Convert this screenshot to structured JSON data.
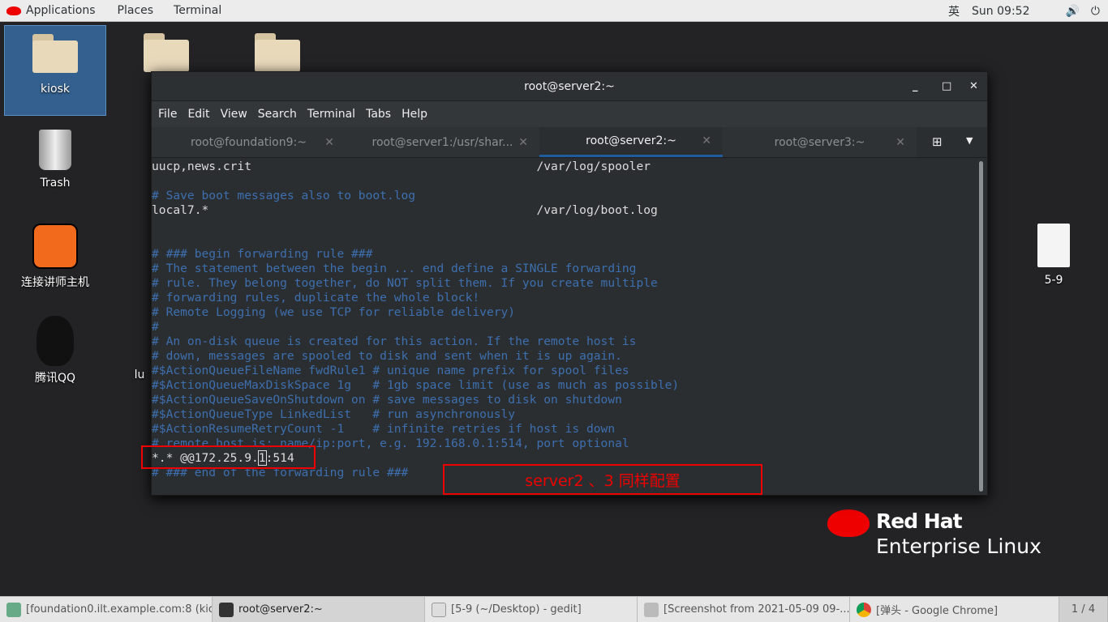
{
  "topbar": {
    "menus": [
      "Applications",
      "Places",
      "Terminal"
    ],
    "ime": "英",
    "clock": "Sun 09:52"
  },
  "desktop": {
    "icons": [
      "kiosk",
      "Trash",
      "连接讲师主机",
      "腾讯QQ",
      "lu",
      "5-9"
    ],
    "brand_line1": "Red Hat",
    "brand_line2": "Enterprise Linux"
  },
  "window": {
    "title": "root@server2:~",
    "menu": [
      "File",
      "Edit",
      "View",
      "Search",
      "Terminal",
      "Tabs",
      "Help"
    ],
    "tabs": [
      {
        "label": "root@foundation9:~"
      },
      {
        "label": "root@server1:/usr/shar..."
      },
      {
        "label": "root@server2:~",
        "active": true
      },
      {
        "label": "root@server3:~"
      }
    ]
  },
  "terminal": {
    "lines": [
      {
        "t": "uucp,news.crit                                        /var/log/spooler",
        "c": false
      },
      {
        "t": "",
        "c": false
      },
      {
        "t": "# Save boot messages also to boot.log",
        "c": true
      },
      {
        "t": "local7.*                                              /var/log/boot.log",
        "c": false
      },
      {
        "t": "",
        "c": false
      },
      {
        "t": "",
        "c": false
      },
      {
        "t": "# ### begin forwarding rule ###",
        "c": true
      },
      {
        "t": "# The statement between the begin ... end define a SINGLE forwarding",
        "c": true
      },
      {
        "t": "# rule. They belong together, do NOT split them. If you create multiple",
        "c": true
      },
      {
        "t": "# forwarding rules, duplicate the whole block!",
        "c": true
      },
      {
        "t": "# Remote Logging (we use TCP for reliable delivery)",
        "c": true
      },
      {
        "t": "#",
        "c": true
      },
      {
        "t": "# An on-disk queue is created for this action. If the remote host is",
        "c": true
      },
      {
        "t": "# down, messages are spooled to disk and sent when it is up again.",
        "c": true
      },
      {
        "t": "#$ActionQueueFileName fwdRule1 # unique name prefix for spool files",
        "c": true
      },
      {
        "t": "#$ActionQueueMaxDiskSpace 1g   # 1gb space limit (use as much as possible)",
        "c": true
      },
      {
        "t": "#$ActionQueueSaveOnShutdown on # save messages to disk on shutdown",
        "c": true
      },
      {
        "t": "#$ActionQueueType LinkedList   # run asynchronously",
        "c": true
      },
      {
        "t": "#$ActionResumeRetryCount -1    # infinite retries if host is down",
        "c": true
      },
      {
        "t": "# remote host is: name/ip:port, e.g. 192.168.0.1:514, port optional",
        "c": true
      }
    ],
    "edit_line": {
      "before": "*.* @@172.25.9.",
      "cursor": "1",
      "after": ":514"
    },
    "last_line": "# ### end of the forwarding rule ###"
  },
  "annotation": {
    "text": "server2 、3 同样配置",
    "color": "#e00000"
  },
  "taskbar": {
    "items": [
      "[foundation0.ilt.example.com:8 (kio...",
      "root@server2:~",
      "[5-9 (~/Desktop) - gedit]",
      "[Screenshot from 2021-05-09 09-...",
      "[弹头 - Google Chrome]"
    ],
    "pager": "1 / 4"
  }
}
